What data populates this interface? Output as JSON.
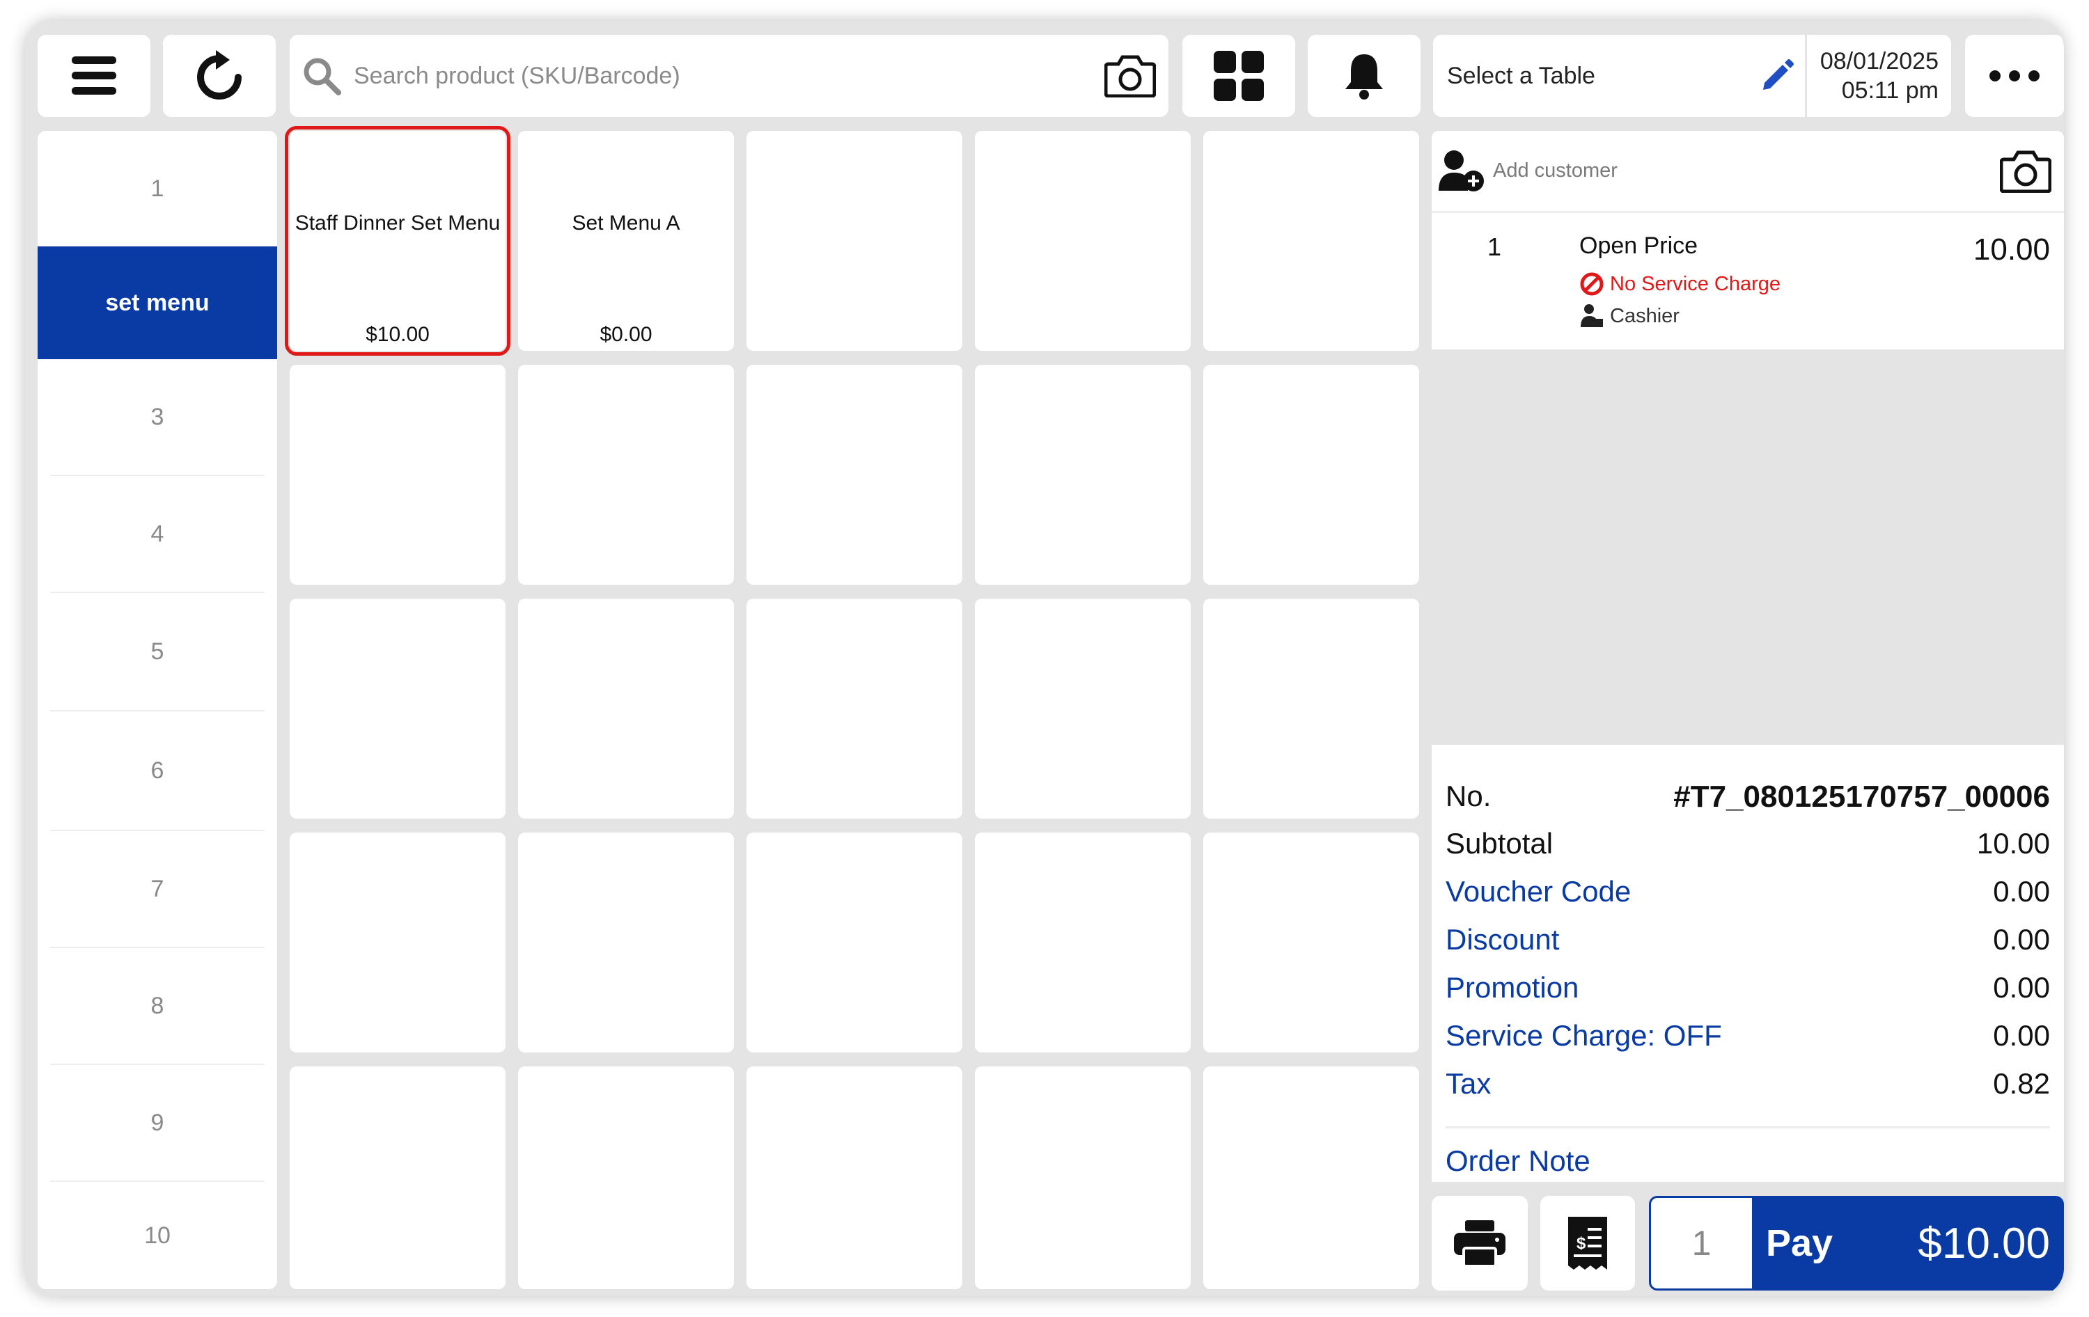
{
  "toolbar": {
    "search_placeholder": "Search product (SKU/Barcode)",
    "table_label": "Select a Table",
    "date": "08/01/2025",
    "time": "05:11 pm"
  },
  "categories": [
    {
      "label": "1",
      "active": false
    },
    {
      "label": "set menu",
      "active": true
    },
    {
      "label": "3",
      "active": false
    },
    {
      "label": "4",
      "active": false
    },
    {
      "label": "5",
      "active": false
    },
    {
      "label": "6",
      "active": false
    },
    {
      "label": "7",
      "active": false
    },
    {
      "label": "8",
      "active": false
    },
    {
      "label": "9",
      "active": false
    },
    {
      "label": "10",
      "active": false
    }
  ],
  "products": [
    {
      "name": "Staff Dinner Set Menu",
      "price": "$10.00",
      "selected": true
    },
    {
      "name": "Set Menu A",
      "price": "$0.00",
      "selected": false
    }
  ],
  "cart": {
    "add_customer": "Add customer",
    "items": [
      {
        "qty": "1",
        "name": "Open Price",
        "price": "10.00",
        "note": "No Service Charge",
        "staff": "Cashier"
      }
    ]
  },
  "summary": {
    "order_no_label": "No.",
    "order_no": "#T7_080125170757_00006",
    "rows": [
      {
        "label": "Subtotal",
        "value": "10.00",
        "link": false
      },
      {
        "label": "Voucher Code",
        "value": "0.00",
        "link": true
      },
      {
        "label": "Discount",
        "value": "0.00",
        "link": true
      },
      {
        "label": "Promotion",
        "value": "0.00",
        "link": true
      },
      {
        "label": "Service Charge: OFF",
        "value": "0.00",
        "link": true
      },
      {
        "label": "Tax",
        "value": "0.82",
        "link": false
      }
    ],
    "order_note": "Order Note"
  },
  "pay": {
    "qty": "1",
    "label": "Pay",
    "amount": "$10.00"
  },
  "colors": {
    "accent": "#0a3aa3",
    "alert": "#e01818",
    "background": "#e4e4e4"
  }
}
